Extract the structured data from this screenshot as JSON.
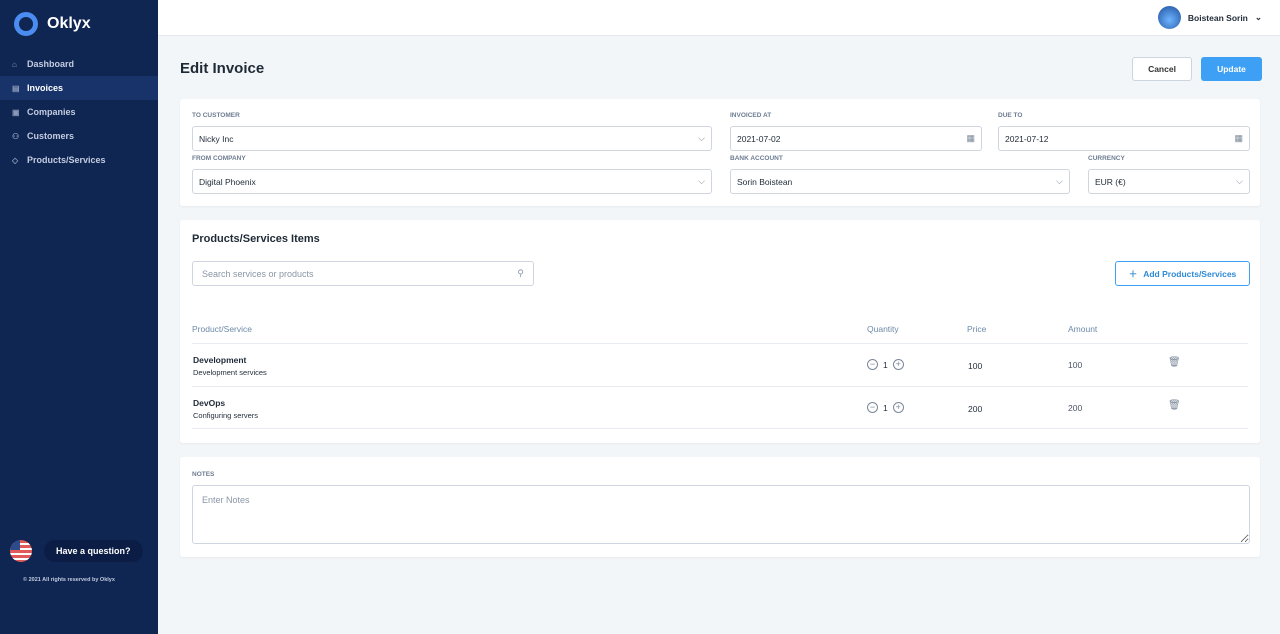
{
  "app": {
    "name": "Oklyx"
  },
  "sidebar": {
    "items": [
      {
        "label": "Dashboard",
        "icon": "home-icon"
      },
      {
        "label": "Invoices",
        "icon": "invoice-icon"
      },
      {
        "label": "Companies",
        "icon": "briefcase-icon"
      },
      {
        "label": "Customers",
        "icon": "users-icon"
      },
      {
        "label": "Products/Services",
        "icon": "tag-icon"
      }
    ],
    "help": "Have a question?",
    "copyright": "© 2021 All rights reserved by Oklyx"
  },
  "user": {
    "name": "Boistean Sorin"
  },
  "page": {
    "title": "Edit Invoice",
    "cancel": "Cancel",
    "update": "Update"
  },
  "form": {
    "to_customer": {
      "label": "To Customer",
      "value": "Nicky Inc"
    },
    "invoiced_at": {
      "label": "Invoiced At",
      "value": "2021-07-02"
    },
    "due_to": {
      "label": "Due To",
      "value": "2021-07-12"
    },
    "from_company": {
      "label": "From Company",
      "value": "Digital Phoenix"
    },
    "bank_account": {
      "label": "Bank Account",
      "value": "Sorin Boistean"
    },
    "currency": {
      "label": "Currency",
      "value": "EUR (€)"
    }
  },
  "items": {
    "title": "Products/Services Items",
    "search_placeholder": "Search services or products",
    "add": "Add Products/Services",
    "headers": [
      "Product/Service",
      "Quantity",
      "Price",
      "Amount"
    ],
    "rows": [
      {
        "name": "Development",
        "desc": "Development services",
        "qty": "1",
        "price": "100",
        "amount": "100"
      },
      {
        "name": "DevOps",
        "desc": "Configuring servers",
        "qty": "1",
        "price": "200",
        "amount": "200"
      }
    ]
  },
  "notes": {
    "label": "Notes",
    "placeholder": "Enter Notes"
  }
}
